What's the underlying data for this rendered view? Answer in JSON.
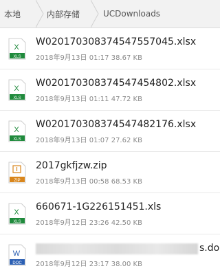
{
  "breadcrumb": [
    "本地",
    "内部存储",
    "UCDownloads"
  ],
  "files": [
    {
      "type": "xls",
      "badge": "XLS",
      "glyph": "X",
      "name": "W020170308374547557045.xlsx",
      "meta": "2018年9月13日 01:17 38.67 KB"
    },
    {
      "type": "xls",
      "badge": "XLS",
      "glyph": "X",
      "name": "W020170308374547454802.xlsx",
      "meta": "2018年9月13日 01:11 47.72 KB"
    },
    {
      "type": "xls",
      "badge": "XLS",
      "glyph": "X",
      "name": "W020170308374547482176.xlsx",
      "meta": "2018年9月13日 01:07 27.62 KB"
    },
    {
      "type": "zip",
      "badge": "ZIP",
      "glyph": "",
      "name": "2017gkfjzw.zip",
      "meta": "2018年9月13日 00:58 68.53 KB"
    },
    {
      "type": "xls",
      "badge": "XLS",
      "glyph": "X",
      "name": "660671-1G226151451.xls",
      "meta": "2018年9月12日 23:26 42.50 KB"
    },
    {
      "type": "doc",
      "badge": "DOC",
      "glyph": "W",
      "name": "s.doc",
      "meta": "2018年9月12日 23:17 38.00 KB"
    }
  ],
  "colors": {
    "xls": "#1f8a3c",
    "zip": "#d9861c",
    "doc": "#2b5fb3"
  }
}
